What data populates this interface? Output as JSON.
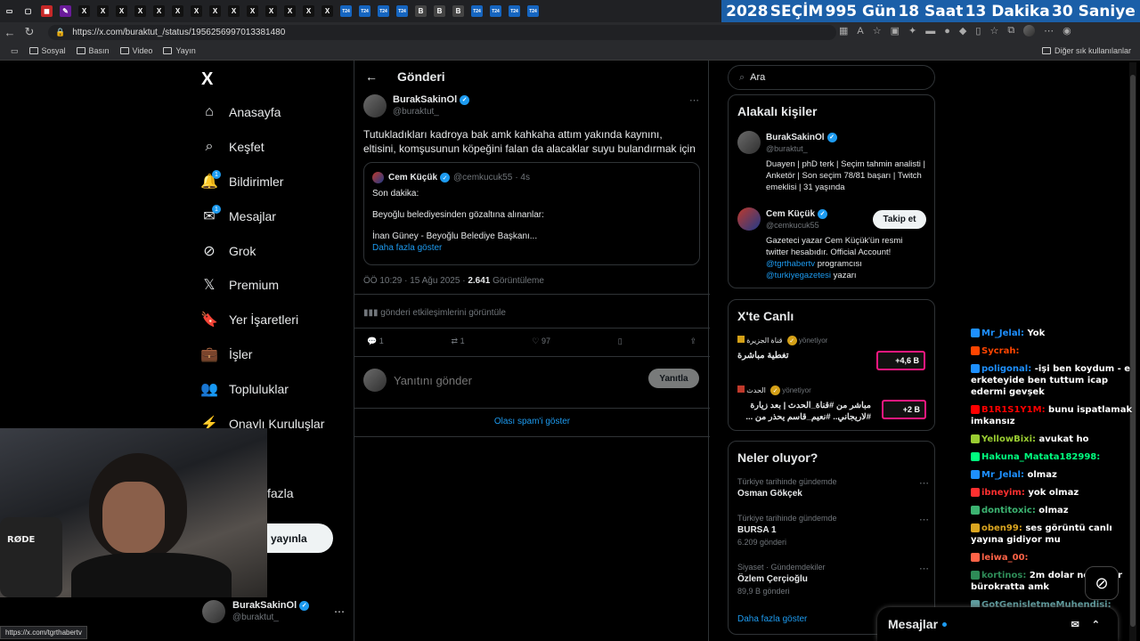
{
  "browser": {
    "countdown": {
      "year": "2028",
      "label": "SEÇİM",
      "days": "995 Gün",
      "hours": "18 Saat",
      "minutes": "13 Dakika",
      "seconds": "30 Saniye"
    },
    "url": "https://x.com/buraktut_/status/1956256997013381480",
    "bookmarks": [
      "Sosyal",
      "Basın",
      "Video",
      "Yayın"
    ],
    "bookmarks_right": "Diğer sık kullanılanlar",
    "tabs": [
      "X",
      "X",
      "X",
      "X",
      "X",
      "X",
      "X",
      "X",
      "X",
      "X",
      "X",
      "X",
      "X",
      "X",
      "T24",
      "T24",
      "T24",
      "T24",
      "B",
      "B",
      "B",
      "T24",
      "T24",
      "T24",
      "T24"
    ]
  },
  "nav": {
    "logo": "X",
    "items": [
      {
        "label": "Anasayfa",
        "icon": "home-icon",
        "glyph": "⌂"
      },
      {
        "label": "Keşfet",
        "icon": "search-icon",
        "glyph": "⌕"
      },
      {
        "label": "Bildirimler",
        "icon": "bell-icon",
        "glyph": "🔔",
        "badge": "1"
      },
      {
        "label": "Mesajlar",
        "icon": "mail-icon",
        "glyph": "✉",
        "badge": "1"
      },
      {
        "label": "Grok",
        "icon": "grok-icon",
        "glyph": "⊘"
      },
      {
        "label": "Premium",
        "icon": "x-premium-icon",
        "glyph": "𝕏"
      },
      {
        "label": "Yer İşaretleri",
        "icon": "bookmark-icon",
        "glyph": "🔖"
      },
      {
        "label": "İşler",
        "icon": "briefcase-icon",
        "glyph": "💼"
      },
      {
        "label": "Topluluklar",
        "icon": "communities-icon",
        "glyph": "👥"
      },
      {
        "label": "Onaylı Kuruluşlar",
        "icon": "lightning-icon",
        "glyph": "⚡"
      }
    ],
    "more_partial": "fazla",
    "post_button": "yayınla",
    "account": {
      "name": "BurakSakinOl",
      "handle": "@buraktut_"
    }
  },
  "status_url": "https://x.com/tgrthabertv",
  "post": {
    "header": "Gönderi",
    "author": {
      "name": "BurakSakinOl",
      "handle": "@buraktut_"
    },
    "text": "Tutukladıkları kadroya bak amk kahkaha attım yakında kaynını, eltisini, komşusunun köpeğini falan da alacaklar suyu bulandırmak için",
    "quote": {
      "name": "Cem Küçük",
      "handle": "@cemkucuk55",
      "time": "· 4s",
      "line1": "Son dakika:",
      "line2": "Beyoğlu belediyesinden gözaltına alınanlar:",
      "line3": "İnan Güney - Beyoğlu Belediye Başkanı...",
      "more": "Daha fazla göster"
    },
    "meta_time": "ÖÖ 10:29 · 15 Ağu 2025 · ",
    "meta_views": "2.641",
    "meta_views_label": " Görüntüleme",
    "engagements": "gönderi etkileşimlerini görüntüle",
    "counts": {
      "replies": "1",
      "reposts": "1",
      "likes": "97"
    },
    "reply_placeholder": "Yanıtını gönder",
    "reply_button": "Yanıtla",
    "spam": "Olası spam'i göster"
  },
  "sidebar": {
    "search_placeholder": "Ara",
    "relevant": {
      "title": "Alakalı kişiler",
      "people": [
        {
          "name": "BurakSakinOl",
          "handle": "@buraktut_",
          "bio": "Duayen | phD terk | Seçim tahmin analisti | Anketör | Son seçim 78/81 başarı | Twitch emeklisi | 31 yaşında"
        },
        {
          "name": "Cem Küçük",
          "handle": "@cemkucuk55",
          "bio": "Gazeteci yazar Cem Küçük'ün resmi twitter hesabıdır. Official Account!",
          "mention1": "@tgrthabertv",
          "bio2": " programcısı",
          "mention2": "@turkiyegazetesi",
          "bio3": " yazarı",
          "follow": "Takip et"
        }
      ]
    },
    "live": {
      "title": "X'te Canlı",
      "items": [
        {
          "host": "قناة الجزيرة",
          "role": "yönetiyor",
          "title": "تغطية مباشرة",
          "count": "+4,6 B"
        },
        {
          "host": "الحدث",
          "role": "yönetiyor",
          "title": "مباشر من #قناة_الحدث | بعد زيارة #لاريجاني.. #نعيم_قاسم يحذر من ...",
          "count": "+2 B"
        }
      ]
    },
    "trends": {
      "title": "Neler oluyor?",
      "items": [
        {
          "context": "Türkiye tarihinde gündemde",
          "name": "Osman Gökçek",
          "count": ""
        },
        {
          "context": "Türkiye tarihinde gündemde",
          "name": "BURSA 1",
          "count": "6.209 gönderi"
        },
        {
          "context": "Siyaset · Gündemdekiler",
          "name": "Özlem Çerçioğlu",
          "count": "89,9 B gönderi"
        }
      ],
      "more": "Daha fazla göster"
    }
  },
  "messages_drawer": "Mesajlar",
  "chat": [
    {
      "user": "Mr_Jelal",
      "color": "#1e90ff",
      "msg": "Yok"
    },
    {
      "user": "Sycrah",
      "color": "#ff4500",
      "msg": ""
    },
    {
      "user": "poligonal",
      "color": "#1e90ff",
      "msg": "-işi ben koydum - e erketeyide ben tuttum icap edermi gevşek"
    },
    {
      "user": "B1R1S1Y1M",
      "color": "#ff0000",
      "msg": "bunu ispatlamak imkansız"
    },
    {
      "user": "YellowBixi",
      "color": "#9acd32",
      "msg": "avukat ho"
    },
    {
      "user": "Hakuna_Matata182998",
      "color": "#00ff7f",
      "msg": ""
    },
    {
      "user": "Mr_Jelal",
      "color": "#1e90ff",
      "msg": "olmaz"
    },
    {
      "user": "ibneyim",
      "color": "#ff3030",
      "msg": "yok olmaz"
    },
    {
      "user": "dontitoxic",
      "color": "#3cb371",
      "msg": "olmaz"
    },
    {
      "user": "oben99",
      "color": "#daa520",
      "msg": "ses görüntü canlı yayına gidiyor mu"
    },
    {
      "user": "leiwa_00",
      "color": "#ff6347",
      "msg": ""
    },
    {
      "user": "kortinos",
      "color": "#2e8b57",
      "msg": "2m dolar ne arıyor bürokratta amk"
    },
    {
      "user": "GotGenisletmeMuhendisi",
      "color": "#5f9ea0",
      "msg": ""
    }
  ],
  "colors": {
    "accent": "#1d9bf0",
    "live_border": "#f91880",
    "countdown_bg": "#1b5fa8"
  }
}
